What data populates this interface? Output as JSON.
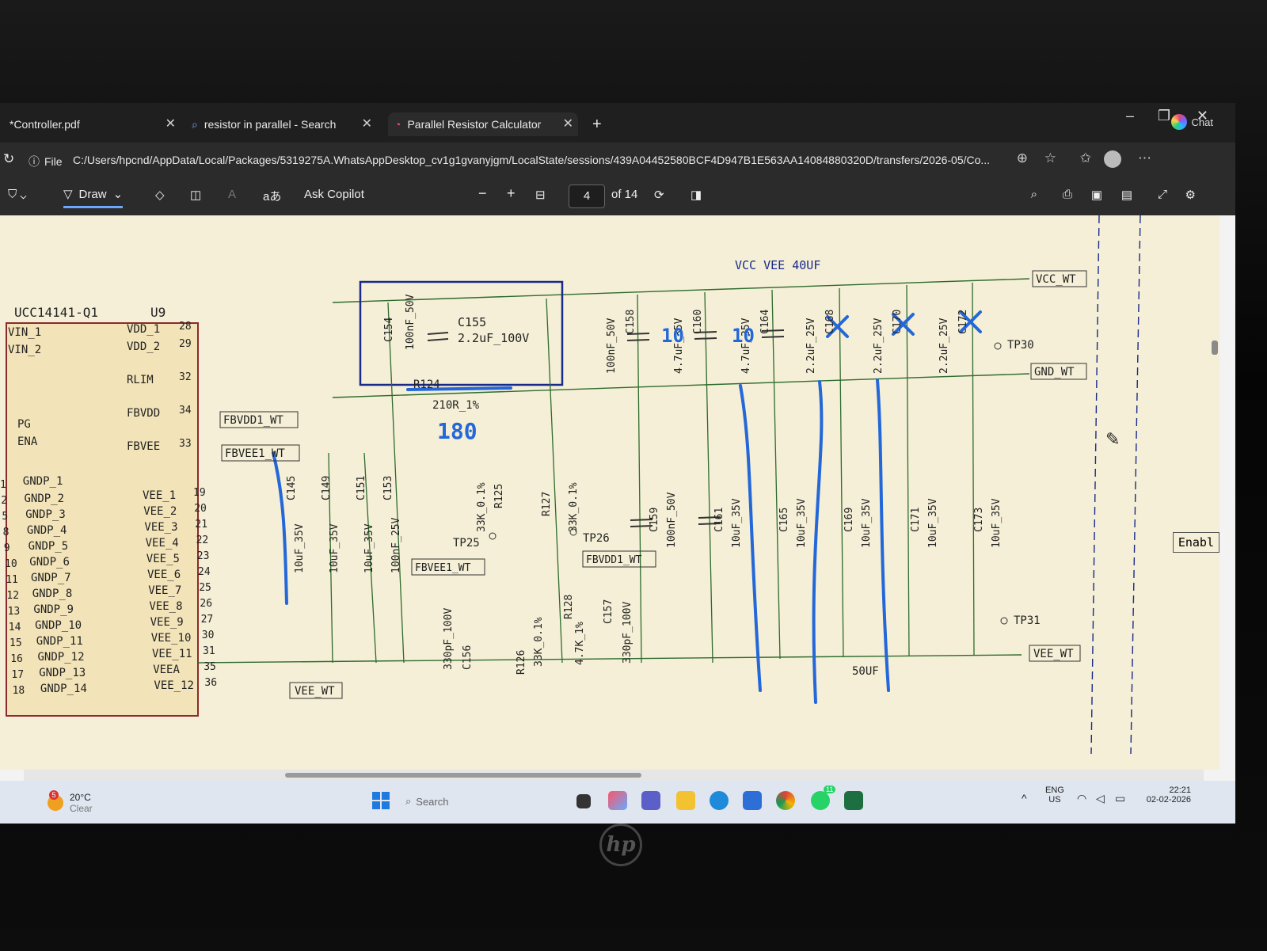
{
  "tabs": [
    {
      "label": "*Controller.pdf",
      "close": "✕"
    },
    {
      "label": "resistor in parallel - Search",
      "close": "✕"
    },
    {
      "label": "Parallel Resistor Calculator",
      "close": "✕"
    }
  ],
  "new_tab_label": "+",
  "chat_label": "Chat",
  "address": {
    "scheme_label": "File",
    "url": "C:/Users/hpcnd/AppData/Local/Packages/5319275A.WhatsAppDesktop_cv1g1gvanyjgm/LocalState/sessions/439A04452580BCF4D947B1E563AA14084880320D/transfers/2026-05/Co..."
  },
  "toolbar": {
    "draw_label": "Draw",
    "ask_copilot_label": "Ask Copilot",
    "aa_label": "aあ",
    "zoom_out": "−",
    "zoom_in": "+",
    "current_page": "4",
    "total_pages": "of 14"
  },
  "side_button_label": "Enabl",
  "schematic": {
    "chip_name": "UCC14141-Q1",
    "chip_ref": "U9",
    "left_pins": [
      "VIN_1",
      "VIN_2",
      "PG",
      "ENA",
      "GNDP_1",
      "GNDP_2",
      "GNDP_3",
      "GNDP_4",
      "GNDP_5",
      "GNDP_6",
      "GNDP_7",
      "GNDP_8",
      "GNDP_9",
      "GNDP_10",
      "GNDP_11",
      "GNDP_12",
      "GNDP_13",
      "GNDP_14"
    ],
    "left_pin_nums": [
      "1",
      "2",
      "5",
      "8",
      "9",
      "10",
      "11",
      "12",
      "13",
      "14",
      "15",
      "16",
      "17",
      "18"
    ],
    "right_pins": [
      "VDD_1",
      "VDD_2",
      "RLIM",
      "FBVDD",
      "FBVEE",
      "VEE_1",
      "VEE_2",
      "VEE_3",
      "VEE_4",
      "VEE_5",
      "VEE_6",
      "VEE_7",
      "VEE_8",
      "VEE_9",
      "VEE_10",
      "VEE_11",
      "VEEA",
      "VEE_12"
    ],
    "right_pin_nums": [
      "28",
      "29",
      "32",
      "34",
      "33",
      "19",
      "20",
      "21",
      "22",
      "23",
      "24",
      "25",
      "26",
      "27",
      "30",
      "31",
      "35",
      "36"
    ],
    "net_labels": {
      "fbvdd1": "FBVDD1_WT",
      "fbvee1": "FBVEE1_WT",
      "vee_wt": "VEE_WT",
      "vcc_wt": "VCC_WT",
      "gnd_wt": "GND_WT",
      "vee_wt_r": "VEE_WT",
      "fbvee1_b": "FBVEE1_WT",
      "fbvdd1_b": "FBVDD1_WT"
    },
    "title_note": "VCC VEE 40UF",
    "c155": "C155",
    "c155_val": "2.2uF_100V",
    "c154": "C154",
    "c154_val": "100nF_50V",
    "r124": "R124",
    "r124_val": "210R_1%",
    "hand_180": "180",
    "top_caps": [
      {
        "ref": "C158",
        "val": "100nF_50V"
      },
      {
        "ref": "C160",
        "val": "4.7uF_35V",
        "hand": "10"
      },
      {
        "ref": "C164",
        "val": "4.7uF_35V",
        "hand": "10"
      },
      {
        "ref": "C168",
        "val": "2.2uF_25V"
      },
      {
        "ref": "C170",
        "val": "2.2uF_25V"
      },
      {
        "ref": "C172",
        "val": "2.2uF_25V"
      }
    ],
    "bottom_caps": [
      {
        "ref": "C159",
        "val": "100nF_50V"
      },
      {
        "ref": "C161",
        "val": "10uF_35V"
      },
      {
        "ref": "C165",
        "val": "10uF_35V"
      },
      {
        "ref": "C169",
        "val": "10uF_35V"
      },
      {
        "ref": "C171",
        "val": "10uF_35V"
      },
      {
        "ref": "C173",
        "val": "10uF_35V"
      }
    ],
    "left_caps": [
      {
        "ref": "C145",
        "val": "10uF_35V"
      },
      {
        "ref": "C149",
        "val": "10uF_35V"
      },
      {
        "ref": "C151",
        "val": "10uF_35V"
      },
      {
        "ref": "C153",
        "val": "100nF_25V"
      }
    ],
    "r125": "R125",
    "r125_val": "33K_0.1%",
    "r127": "R127",
    "r127_val": "33K_0.1%",
    "r126": "R126",
    "r126_val": "33K_0.1%",
    "r128": "R128",
    "r128_val": "4.7K_1%",
    "c156": "C156",
    "c156_val": "330pF_100V",
    "c157": "C157",
    "c157_val": "330pF_100V",
    "tp25": "TP25",
    "tp26": "TP26",
    "tp30": "TP30",
    "tp31": "TP31",
    "note_50uf": "50UF"
  },
  "taskbar": {
    "temp": "20°C",
    "weather": "Clear",
    "search_placeholder": "Search",
    "lang": "ENG",
    "region": "US",
    "time": "22:21",
    "date": "02-02-2026",
    "badge": "5",
    "wa_badge": "11"
  },
  "brand": "hp"
}
